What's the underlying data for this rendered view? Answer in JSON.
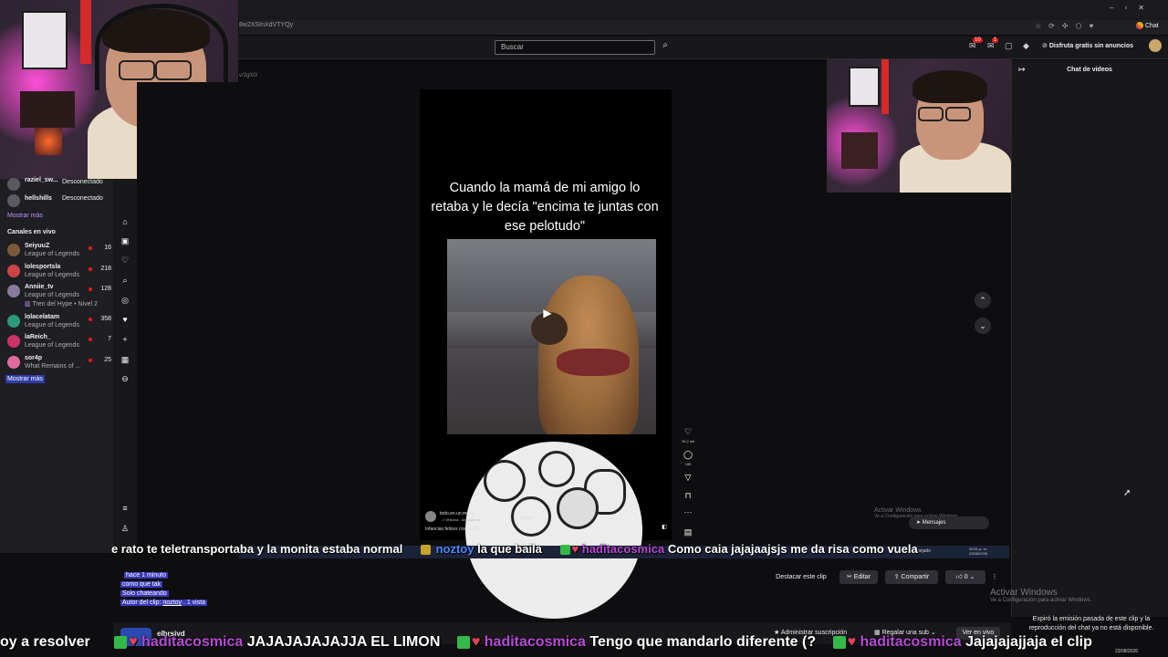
{
  "browser": {
    "url_fragment": "8w2XSInXdVTYQy",
    "url_fragment_2": "v/3gX0/",
    "chat_button": "Chat"
  },
  "header": {
    "search_placeholder": "Buscar",
    "notif_badge_1": "10",
    "notif_badge_2": "1",
    "promo": "Disfruta gratis sin anuncios"
  },
  "sidebar": {
    "offline_users": [
      {
        "name": "raziel_sw...",
        "status": "Desconectado"
      },
      {
        "name": "hellshills",
        "status": "Desconectado"
      }
    ],
    "show_more_1": "Mostrar más",
    "live_heading": "Canales en vivo",
    "live_channels": [
      {
        "name": "SeiyuuZ",
        "game": "League of Legends",
        "viewers": "16"
      },
      {
        "name": "lolesportsla",
        "game": "League of Legends",
        "viewers": "218"
      },
      {
        "name": "Anniie_tv",
        "game": "League of Legends",
        "viewers": "128",
        "extra": "Tren del Hype • Nivel 2"
      },
      {
        "name": "lolacelatam",
        "game": "League of Legends",
        "viewers": "358"
      },
      {
        "name": "laReich_",
        "game": "League of Legends",
        "viewers": "7"
      },
      {
        "name": "sor4p",
        "game": "What Remains of ...",
        "viewers": "25"
      }
    ],
    "show_more_2": "Mostrar más"
  },
  "video": {
    "caption": "Cuando la mamá de mi amigo lo retaba y le decía \"encima te juntas con ese pelotudo\"",
    "like_count": "34,2 mil",
    "comment_count": "185",
    "bottom_user": "todo.en.un.meme",
    "bottom_follow": "Seguir",
    "bottom_desc": "Infancias felices cracknuts",
    "bottom_sound": "♫ Veisona - Mandarinas",
    "messages_label": "Mensajes"
  },
  "windows_watermark": {
    "line1": "Activar Windows",
    "line2": "Ve a Configuración para activar Windows."
  },
  "chat": {
    "title": "Chat de videos",
    "expired_text": "Expiró la emisión pasada de este clip y la reproducción del chat ya no está disponible."
  },
  "ticker_top": {
    "segments": [
      {
        "user": "",
        "text": "e rato te teletransportaba y la monita estaba normal"
      },
      {
        "user": "noztoy",
        "text": "la que baila"
      },
      {
        "user": "haditacosmica",
        "text": "Como caia jajajaajsjs me da risa como vuela"
      }
    ]
  },
  "ticker_bottom": {
    "segments": [
      {
        "user": "",
        "text": "oy a resolver"
      },
      {
        "user": "haditacosmica",
        "text": "JAJAJAJAJAJJA EL LIMON"
      },
      {
        "user": "haditacosmica",
        "text": "Tengo que mandarlo diferente (?"
      },
      {
        "user": "haditacosmica",
        "text": "Jajajajajjaja el clip"
      }
    ]
  },
  "clip_info": {
    "time_ago": "hace 1 minuto",
    "title": "como que tak",
    "category": "Solo chateando",
    "author_prefix": "Autor del clip:",
    "author": "noztoy",
    "views": ". 1 vista"
  },
  "clip_actions": {
    "feature": "Destacar este clip",
    "edit": "Editar",
    "share": "Compartir",
    "likes": "0"
  },
  "channel_bar": {
    "channel_name": "elbrsivd",
    "manage_sub": "Administrar suscripción",
    "gift_sub": "Regalar una sub",
    "watch_live": "Ver en vivo"
  },
  "taskbar": {
    "time": "09:51 p. m.",
    "date": "23/08/2026",
    "desk_label": "Despejado",
    "bottom_date": "23/08/2026"
  }
}
